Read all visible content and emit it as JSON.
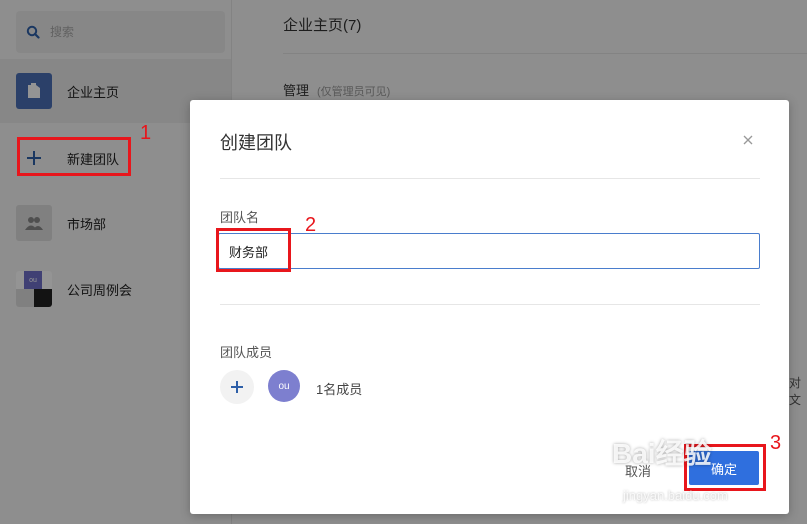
{
  "sidebar": {
    "search_placeholder": "搜索",
    "items": [
      {
        "label": "企业主页"
      },
      {
        "label": "新建团队"
      },
      {
        "label": "市场部"
      },
      {
        "label": "公司周例会"
      }
    ],
    "avatar_text": "ou"
  },
  "main": {
    "title": "企业主页(7)",
    "manage_label": "管理",
    "manage_note": "(仅管理员可见)",
    "side_text": "对文"
  },
  "modal": {
    "title": "创建团队",
    "team_name_label": "团队名",
    "team_name_value": "财务部",
    "members_label": "团队成员",
    "member_avatar": "ou",
    "member_count": "1名成员",
    "cancel_label": "取消",
    "ok_label": "确定"
  },
  "annotations": [
    "1",
    "2",
    "3"
  ],
  "watermark": {
    "text": "Bai经验",
    "sub": "jingyan.baidu.com"
  },
  "colors": {
    "accent": "#2f6fde",
    "highlight": "#e8161c",
    "avatar": "#7d7fcf",
    "home_icon": "#4a6fb5"
  }
}
